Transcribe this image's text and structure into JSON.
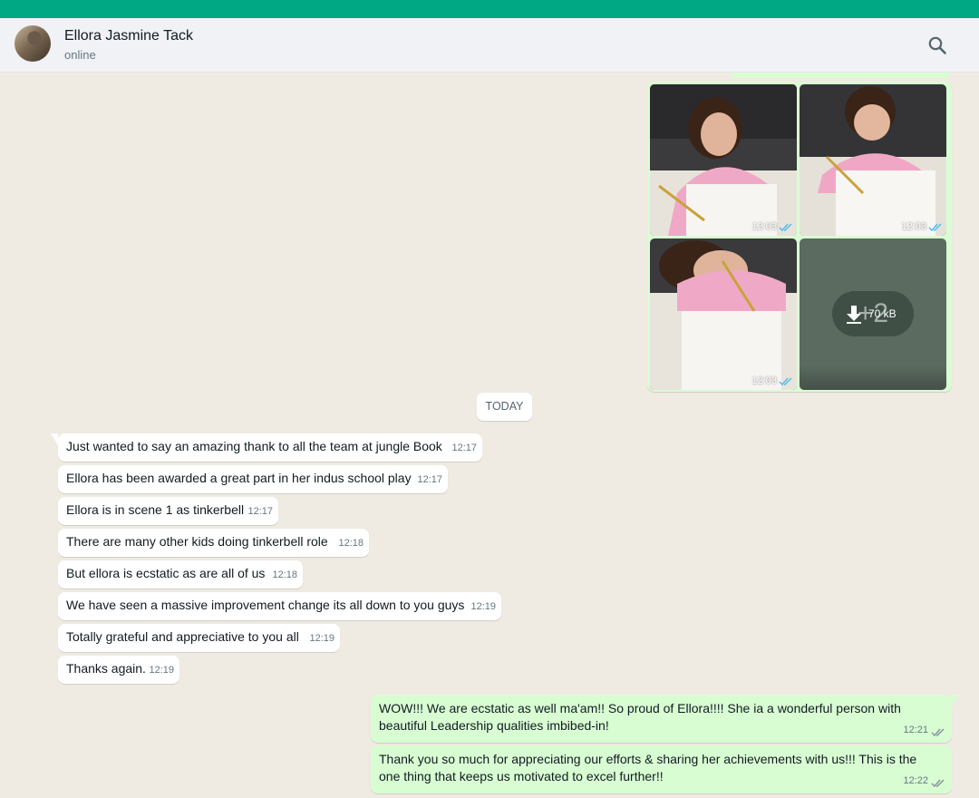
{
  "contact": {
    "name": "Ellora Jasmine Tack",
    "status": "online"
  },
  "header": {
    "search_icon": "search-icon"
  },
  "media": {
    "photos": [
      {
        "time": "12:03",
        "ticks": "double-check-icon"
      },
      {
        "time": "12:03",
        "ticks": "double-check-icon"
      },
      {
        "time": "12:03",
        "ticks": "double-check-icon"
      }
    ],
    "more": {
      "count": "+2",
      "size": "70 kB",
      "icon": "download-icon"
    }
  },
  "date_chip": "TODAY",
  "incoming": [
    {
      "text": "Just wanted to say an amazing thank to all the team at jungle Book",
      "time": "12:17"
    },
    {
      "text": "Ellora has been awarded a great part in her indus school play",
      "time": "12:17"
    },
    {
      "text": "Ellora is in scene 1 as tinkerbell",
      "time": "12:17"
    },
    {
      "text": "There are many other kids doing tinkerbell role",
      "time": "12:18"
    },
    {
      "text": "But ellora is  ecstatic as are all of us",
      "time": "12:18"
    },
    {
      "text": "We have seen a massive improvement change its all down to you guys",
      "time": "12:19"
    },
    {
      "text": "Totally grateful and appreciative to you all",
      "time": "12:19"
    },
    {
      "text": "Thanks again.",
      "time": "12:19"
    }
  ],
  "outgoing": [
    {
      "text": "WOW!!! We are ecstatic as well ma'am!! So proud of Ellora!!!! She ia a wonderful person with beautiful Leadership qualities imbibed-in!",
      "time": "12:21"
    },
    {
      "text": "Thank you so much for appreciating our efforts & sharing her achievements with us!!! This is the one thing that keeps us motivated to excel further!!",
      "time": "12:22"
    }
  ],
  "colors": {
    "accent": "#00a884",
    "outgoing_bubble": "#d9fdd3",
    "read_ticks": "#53bdeb",
    "background": "#efeae2"
  }
}
